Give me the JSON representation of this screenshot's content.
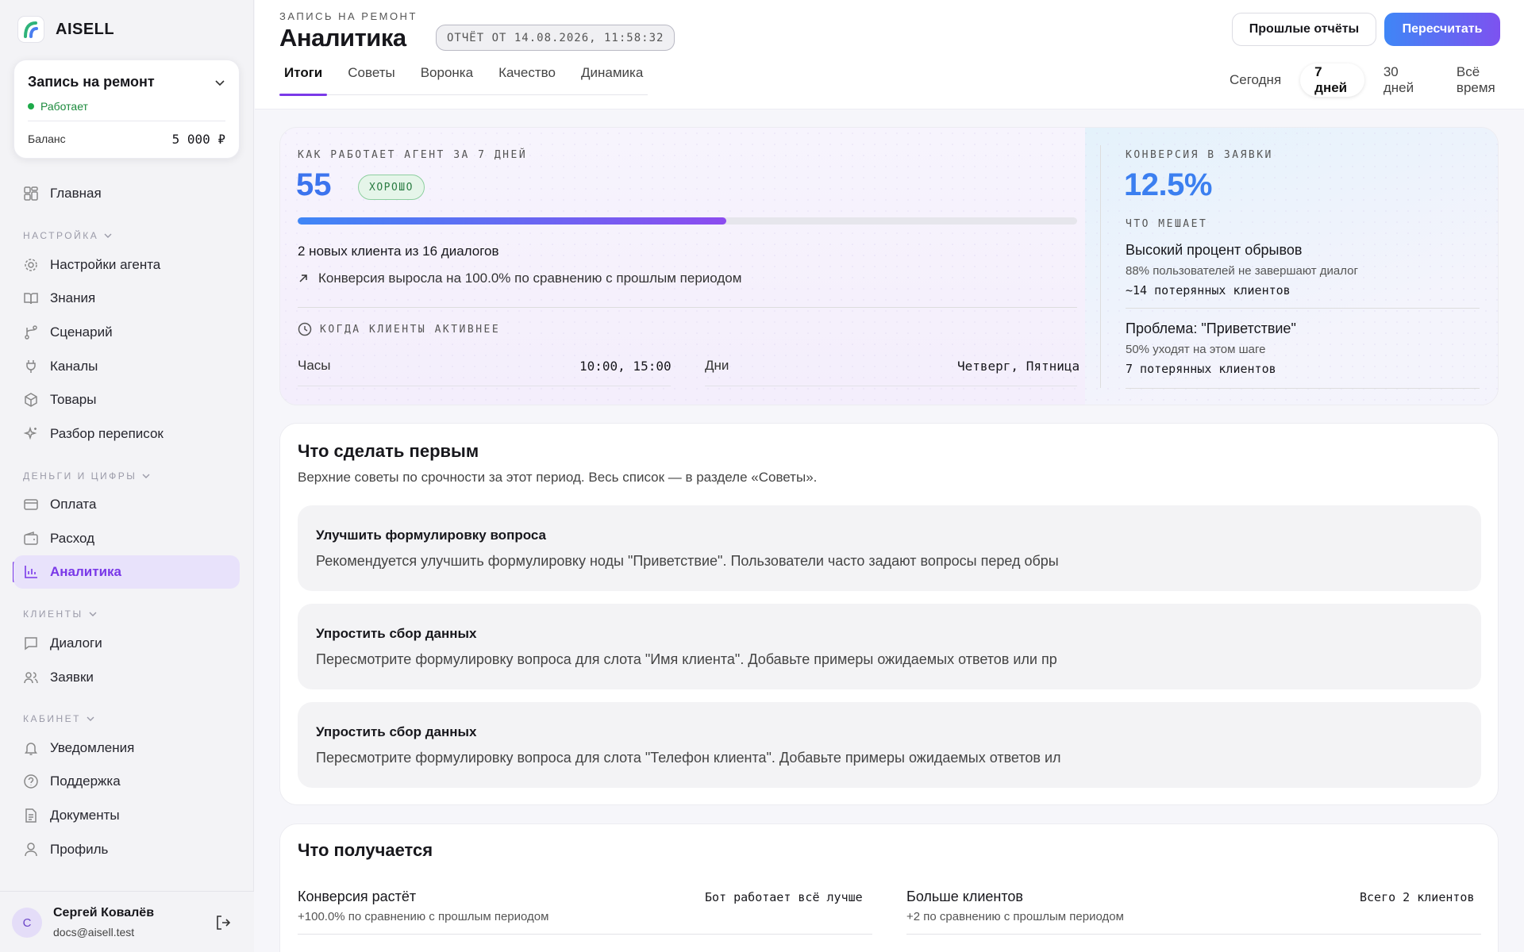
{
  "brand": {
    "name": "AISELL"
  },
  "project": {
    "name": "Запись на ремонт",
    "status": "Работает",
    "balance_label": "Баланс",
    "balance_value": "5 000 ₽"
  },
  "nav": {
    "home": "Главная",
    "settings_section": "НАСТРОЙКА",
    "agent_settings": "Настройки агента",
    "knowledge": "Знания",
    "scenario": "Сценарий",
    "channels": "Каналы",
    "products": "Товары",
    "review": "Разбор переписок",
    "money_section": "ДЕНЬГИ И ЦИФРЫ",
    "payment": "Оплата",
    "expense": "Расход",
    "analytics": "Аналитика",
    "clients_section": "КЛИЕНТЫ",
    "dialogs": "Диалоги",
    "requests": "Заявки",
    "cabinet_section": "КАБИНЕТ",
    "notifications": "Уведомления",
    "support": "Поддержка",
    "documents": "Документы",
    "profile": "Профиль"
  },
  "user": {
    "initial": "С",
    "name": "Сергей Ковалёв",
    "email": "docs@aisell.test"
  },
  "header": {
    "breadcrumb": "ЗАПИСЬ НА РЕМОНТ",
    "title": "Аналитика",
    "report_badge": "ОТЧЁТ ОТ 14.08.2026, 11:58:32",
    "past_reports": "Прошлые отчёты",
    "recalculate": "Пересчитать",
    "tabs": [
      "Итоги",
      "Советы",
      "Воронка",
      "Качество",
      "Динамика"
    ],
    "periods": [
      "Сегодня",
      "7 дней",
      "30 дней",
      "Всё время"
    ],
    "active_period": "7 дней"
  },
  "summary": {
    "label": "КАК РАБОТАЕТ АГЕНТ ЗА 7 ДНЕЙ",
    "score": "55",
    "score_badge": "ХОРОШО",
    "progress": 0.55,
    "clients_text": "2 новых клиента из 16 диалогов",
    "conversion_text": "Конверсия выросла на 100.0% по сравнению с прошлым периодом",
    "active_label": "КОГДА КЛИЕНТЫ АКТИВНЕЕ",
    "hours_label": "Часы",
    "hours_value": "10:00, 15:00",
    "days_label": "Дни",
    "days_value": "Четверг, Пятница",
    "conv_label": "КОНВЕРСИЯ В ЗАЯВКИ",
    "conv_value": "12.5%",
    "hurts_label": "ЧТО МЕШАЕТ",
    "problems": [
      {
        "title": "Высокий процент обрывов",
        "sub": "88% пользователей не завершают диалог",
        "lost": "~14 потерянных клиентов"
      },
      {
        "title": "Проблема: \"Приветствие\"",
        "sub": "50% уходят на этом шаге",
        "lost": "7 потерянных клиентов"
      }
    ]
  },
  "first": {
    "title": "Что сделать первым",
    "subtitle": "Верхние советы по срочности за этот период. Весь список — в разделе «Советы».",
    "tips": [
      {
        "title": "Улучшить формулировку вопроса",
        "desc": "Рекомендуется улучшить формулировку ноды \"Приветствие\". Пользователи часто задают вопросы перед обры"
      },
      {
        "title": "Упростить сбор данных",
        "desc": "Пересмотрите формулировку вопроса для слота \"Имя клиента\". Добавьте примеры ожидаемых ответов или пр"
      },
      {
        "title": "Упростить сбор данных",
        "desc": "Пересмотрите формулировку вопроса для слота \"Телефон клиента\". Добавьте примеры ожидаемых ответов ил"
      }
    ]
  },
  "result": {
    "title": "Что получается",
    "items": [
      {
        "title": "Конверсия растёт",
        "sub": "+100.0% по сравнению с прошлым периодом",
        "right": "Бот работает всё лучше"
      },
      {
        "title": "Больше клиентов",
        "sub": "+2 по сравнению с прошлым периодом",
        "right": "Всего 2 клиентов"
      }
    ]
  },
  "colors": {
    "accent": "#7a39e8",
    "blue": "#3c74ee",
    "success": "#1eaa4a"
  }
}
